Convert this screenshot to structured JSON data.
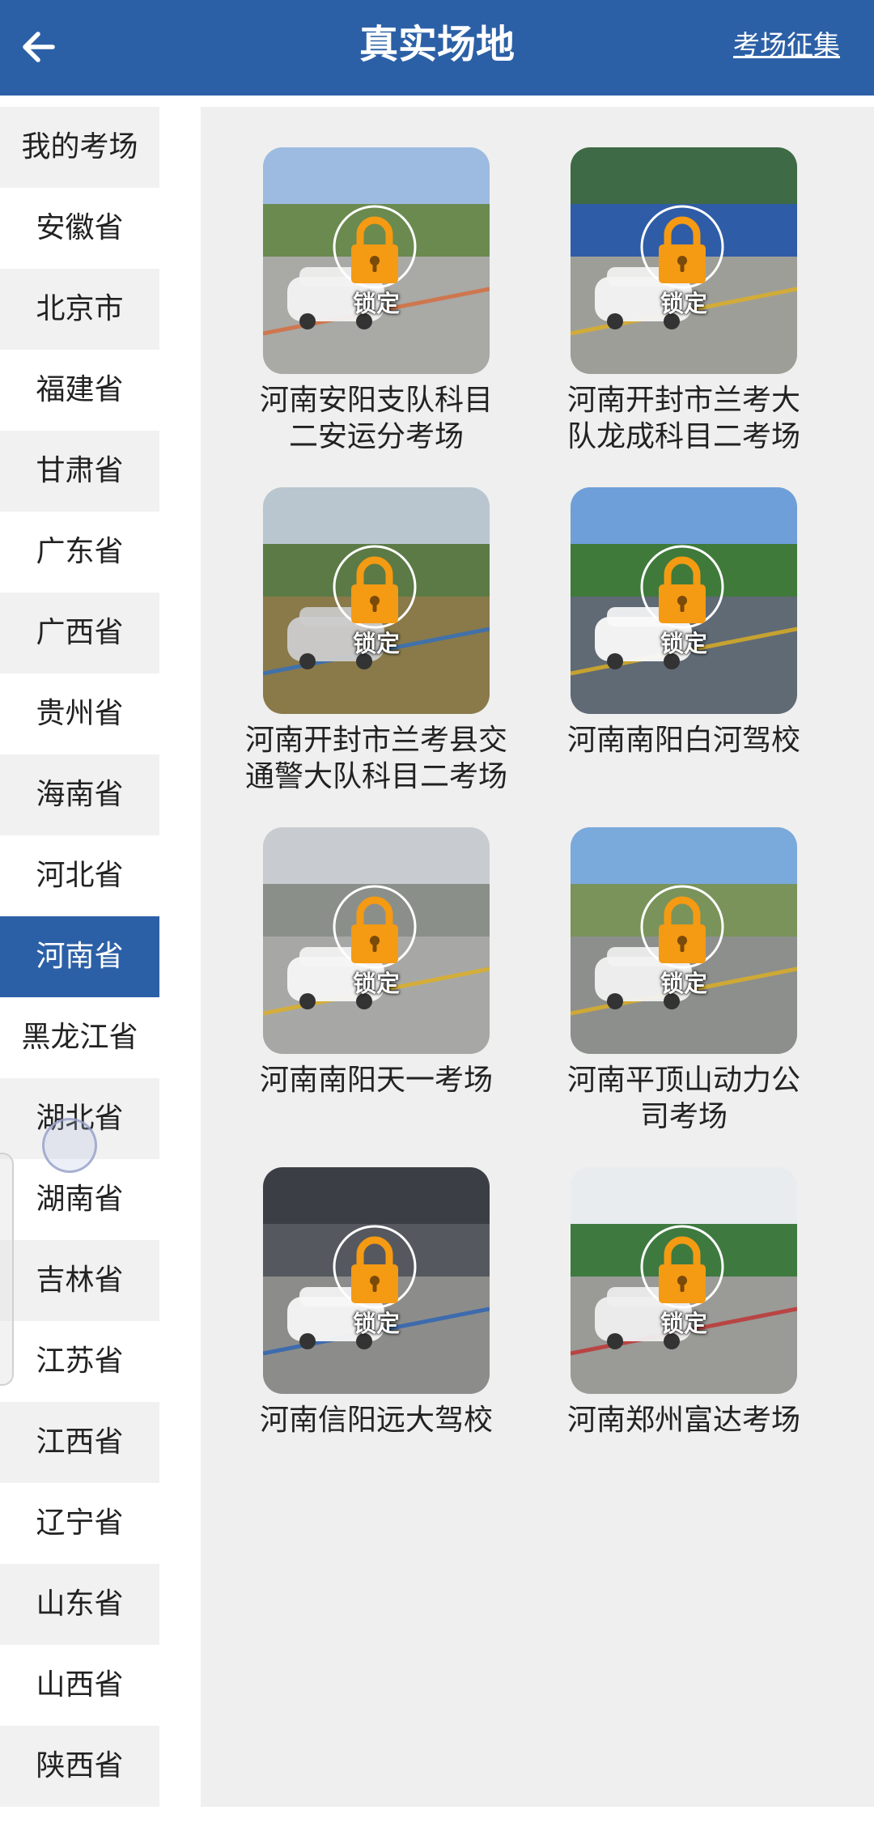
{
  "header": {
    "title": "真实场地",
    "right_link": "考场征集"
  },
  "colors": {
    "primary": "#2c60a6",
    "lock_orange": "#f59a13"
  },
  "sidebar": {
    "items": [
      {
        "label": "我的考场",
        "active": false
      },
      {
        "label": "安徽省",
        "active": false
      },
      {
        "label": "北京市",
        "active": false
      },
      {
        "label": "福建省",
        "active": false
      },
      {
        "label": "甘肃省",
        "active": false
      },
      {
        "label": "广东省",
        "active": false
      },
      {
        "label": "广西省",
        "active": false
      },
      {
        "label": "贵州省",
        "active": false
      },
      {
        "label": "海南省",
        "active": false
      },
      {
        "label": "河北省",
        "active": false
      },
      {
        "label": "河南省",
        "active": true
      },
      {
        "label": "黑龙江省",
        "active": false
      },
      {
        "label": "湖北省",
        "active": false
      },
      {
        "label": "湖南省",
        "active": false
      },
      {
        "label": "吉林省",
        "active": false
      },
      {
        "label": "江苏省",
        "active": false
      },
      {
        "label": "江西省",
        "active": false
      },
      {
        "label": "辽宁省",
        "active": false
      },
      {
        "label": "山东省",
        "active": false
      },
      {
        "label": "山西省",
        "active": false
      },
      {
        "label": "陕西省",
        "active": false
      }
    ]
  },
  "venues": [
    {
      "name_line1": "河南安阳支队科目",
      "name_line2": "二安运分考场",
      "lock_label": "锁定",
      "icon": "lock-icon"
    },
    {
      "name_line1": "河南开封市兰考大",
      "name_line2": "队龙成科目二考场",
      "lock_label": "锁定",
      "icon": "lock-icon"
    },
    {
      "name_line1": "河南开封市兰考县交",
      "name_line2": "通警大队科目二考场",
      "lock_label": "锁定",
      "icon": "lock-icon"
    },
    {
      "name_line1": "河南南阳白河驾校",
      "name_line2": "",
      "lock_label": "锁定",
      "icon": "lock-icon"
    },
    {
      "name_line1": "河南南阳天一考场",
      "name_line2": "",
      "lock_label": "锁定",
      "icon": "lock-icon"
    },
    {
      "name_line1": "河南平顶山动力公",
      "name_line2": "司考场",
      "lock_label": "锁定",
      "icon": "lock-icon"
    },
    {
      "name_line1": "河南信阳远大驾校",
      "name_line2": "",
      "lock_label": "锁定",
      "icon": "lock-icon"
    },
    {
      "name_line1": "河南郑州富达考场",
      "name_line2": "",
      "lock_label": "锁定",
      "icon": "lock-icon"
    }
  ]
}
